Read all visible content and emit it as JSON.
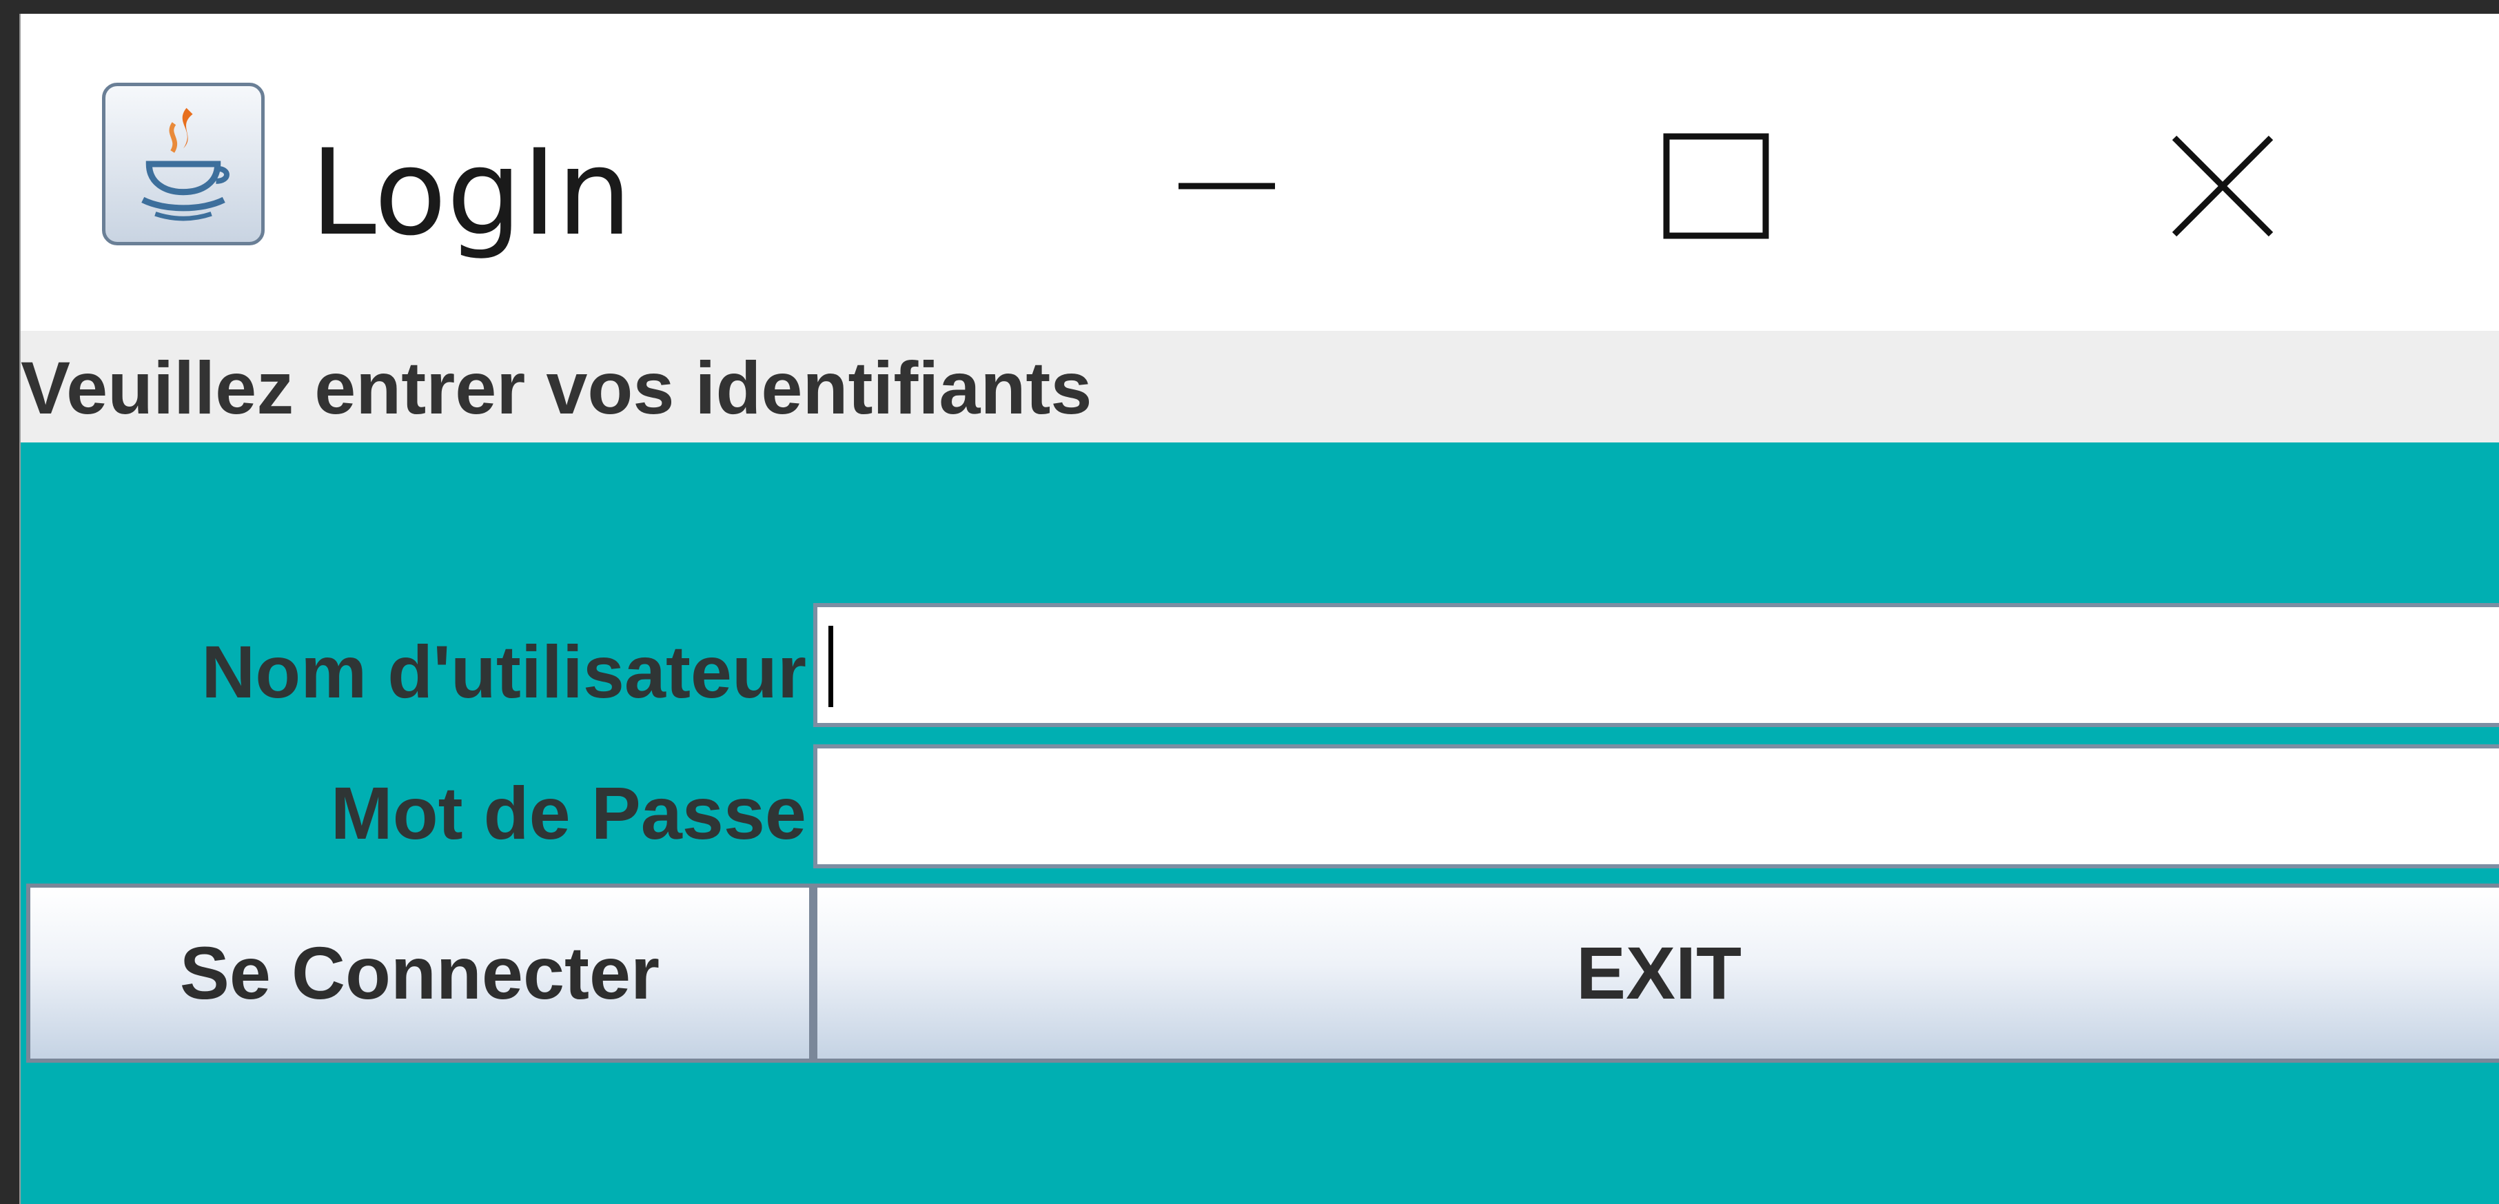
{
  "window": {
    "title": "LogIn",
    "icon": "java-cup-icon",
    "controls": [
      "minimize-icon",
      "maximize-icon",
      "close-icon"
    ]
  },
  "heading": "Veuillez entrer vos identifiants",
  "form": {
    "username_label": "Nom d'utilisateur",
    "username_value": "",
    "password_label": "Mot de Passe",
    "password_value": ""
  },
  "buttons": {
    "connect_label": "Se Connecter",
    "exit_label": "EXIT"
  },
  "colors": {
    "panel_background": "#00afb2",
    "heading_background": "#eeeeee",
    "titlebar_background": "#ffffff"
  }
}
